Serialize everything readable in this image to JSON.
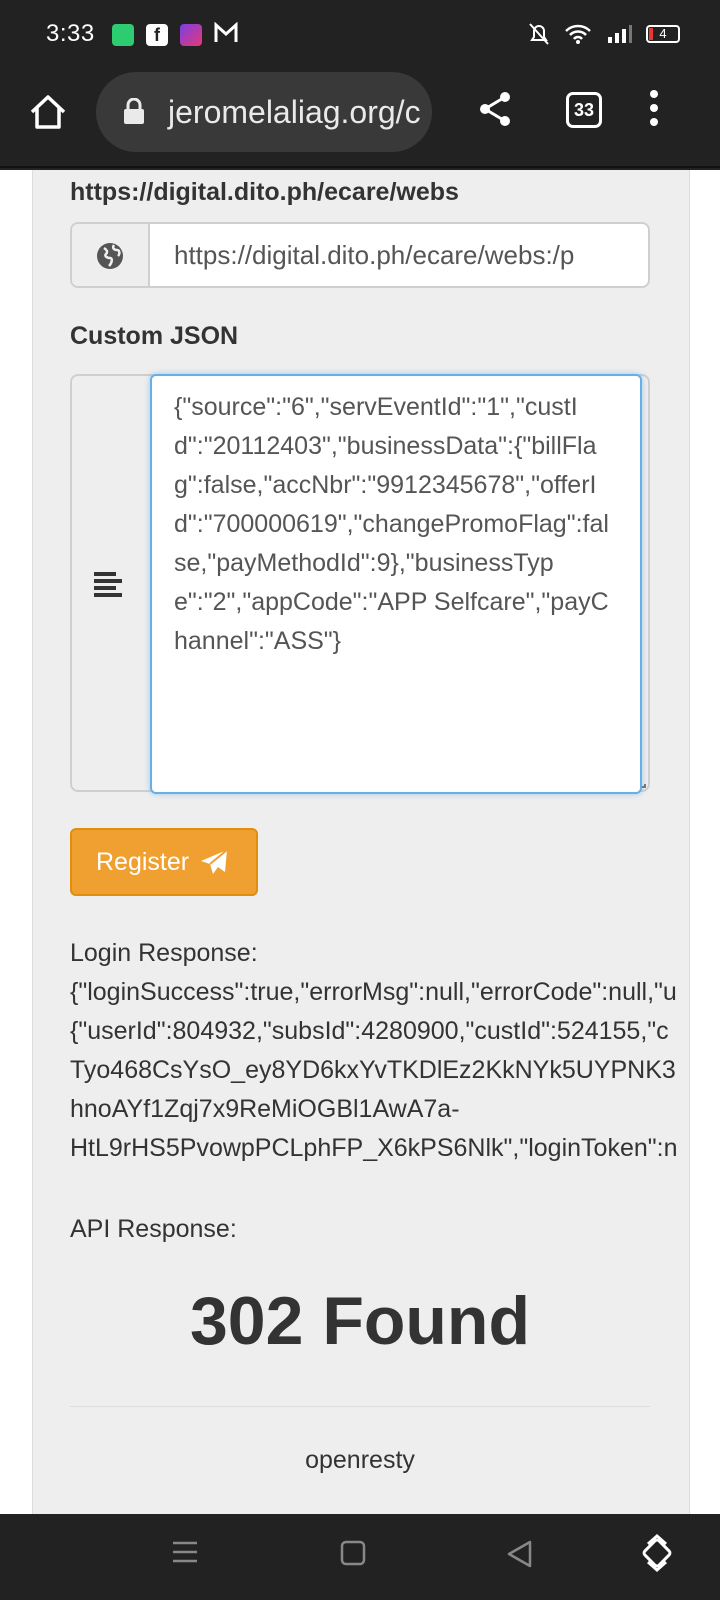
{
  "status_bar": {
    "time": "3:33",
    "battery": "4",
    "notification_icons": [
      "app-icon",
      "facebook-icon",
      "loz-icon",
      "gmail-icon"
    ]
  },
  "browser": {
    "url": "jeromelaliag.org/c",
    "tab_count": "33"
  },
  "form": {
    "endpoint_label": "https://digital.dito.ph/ecare/webs",
    "endpoint_value": "https://digital.dito.ph/ecare/webs:/p",
    "json_label": "Custom JSON",
    "json_value": "{\"source\":\"6\",\"servEventId\":\"1\",\"custId\":\"20112403\",\"businessData\":{\"billFlag\":false,\"accNbr\":\"9912345678\",\"offerId\":\"700000619\",\"changePromoFlag\":false,\"payMethodId\":9},\"businessType\":\"2\",\"appCode\":\"APP Selfcare\",\"payChannel\":\"ASS\"}",
    "register_label": "Register"
  },
  "response": {
    "login_label": "Login Response:",
    "login_lines": [
      "{\"loginSuccess\":true,\"errorMsg\":null,\"errorCode\":null,\"u",
      "{\"userId\":804932,\"subsId\":4280900,\"custId\":524155,\"c",
      "Tyo468CsYsO_ey8YD6kxYvTKDlEz2KkNYk5UYPNK3",
      "hnoAYf1Zqj7x9ReMiOGBl1AwA7a-",
      "HtL9rHS5PvowpPCLphFP_X6kPS6Nlk\",\"loginToken\":n"
    ],
    "api_label": "API Response:",
    "status_title": "302 Found",
    "server_name": "openresty"
  },
  "colors": {
    "accent_orange": "#f0a030",
    "focus_blue": "#66afe9",
    "chrome_dark": "#222222"
  }
}
